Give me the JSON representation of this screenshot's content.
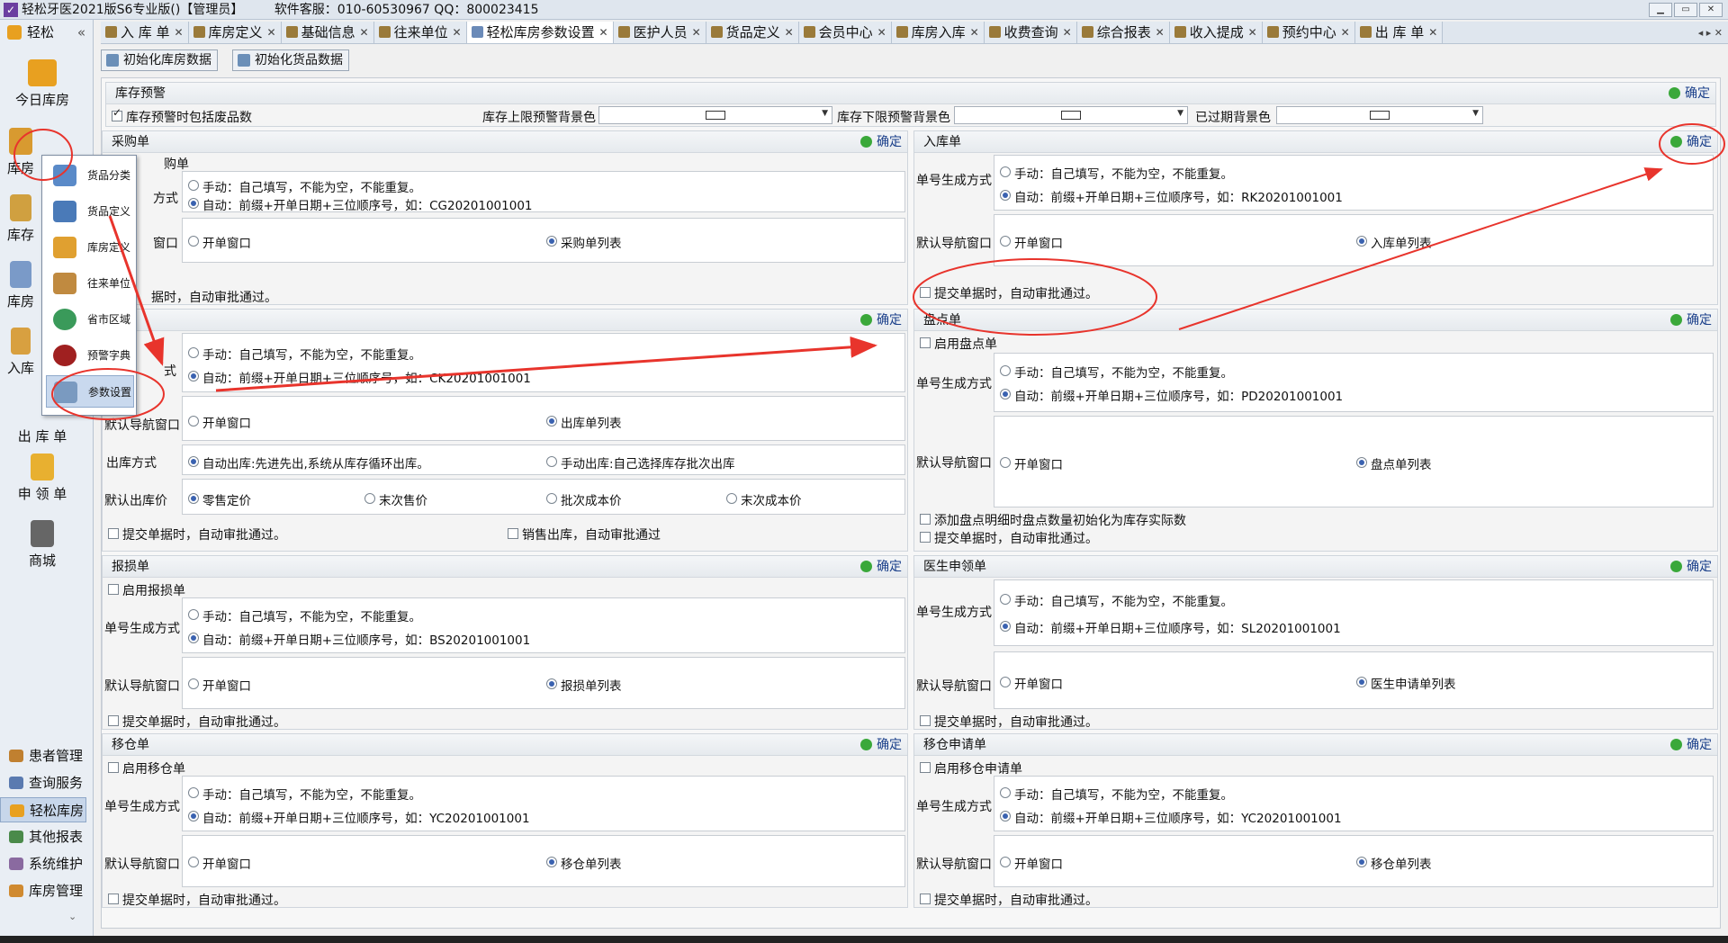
{
  "window": {
    "title": "轻松牙医2021版S6专业版()【管理员】",
    "service": "软件客服：010-60530967 QQ：800023415",
    "controls": [
      "▁",
      "▭",
      "✕"
    ]
  },
  "sidebar": {
    "header": "轻松",
    "collapse": "«",
    "big_items": [
      {
        "label": "今日库房"
      },
      {
        "label": "库房"
      },
      {
        "label": "库存"
      },
      {
        "label": "库房"
      },
      {
        "label": "入库"
      },
      {
        "label": "出 库 单"
      },
      {
        "label": "申 领 单"
      },
      {
        "label": "商城"
      }
    ],
    "bottom_items": [
      {
        "label": "患者管理"
      },
      {
        "label": "查询服务"
      },
      {
        "label": "轻松库房"
      },
      {
        "label": "其他报表"
      },
      {
        "label": "系统维护"
      },
      {
        "label": "库房管理"
      }
    ],
    "bottom_more": "⌄"
  },
  "popup_menu": {
    "items": [
      {
        "label": "货品分类"
      },
      {
        "label": "货品定义"
      },
      {
        "label": "库房定义"
      },
      {
        "label": "往来单位"
      },
      {
        "label": "省市区域"
      },
      {
        "label": "预警字典"
      },
      {
        "label": "参数设置"
      }
    ]
  },
  "tabs": [
    {
      "label": "入 库 单"
    },
    {
      "label": "库房定义"
    },
    {
      "label": "基础信息"
    },
    {
      "label": "往来单位"
    },
    {
      "label": "轻松库房参数设置"
    },
    {
      "label": "医护人员"
    },
    {
      "label": "货品定义"
    },
    {
      "label": "会员中心"
    },
    {
      "label": "库房入库"
    },
    {
      "label": "收费查询"
    },
    {
      "label": "综合报表"
    },
    {
      "label": "收入提成"
    },
    {
      "label": "预约中心"
    },
    {
      "label": "出 库 单"
    }
  ],
  "tab_close": "✕",
  "tab_nav": "◂ ▸ ✕",
  "toolbar": {
    "init_warehouse": "初始化库房数据",
    "init_goods": "初始化货品数据"
  },
  "common": {
    "confirm": "确定",
    "manual": "手动：自己填写，不能为空，不能重复。",
    "auto_prefix": "自动：前缀+开单日期+三位顺序号，如：",
    "number_label": "单号生成方式",
    "nav_label": "默认导航窗口",
    "open_window": "开单窗口",
    "submit_auto": "提交单据时，自动审批通过。"
  },
  "stock_warning": {
    "title": "库存预警",
    "include_waste": "库存预警时包括废品数",
    "upper_bg": "库存上限预警背景色",
    "lower_bg": "库存下限预警背景色",
    "expired_bg": "已过期背景色"
  },
  "purchase": {
    "title": "采购单",
    "sub": "购单",
    "example": "CG20201001001",
    "list": "采购单列表"
  },
  "inbound": {
    "title": "入库单",
    "example": "RK20201001001",
    "list": "入库单列表"
  },
  "outbound": {
    "example": "CK20201001001",
    "list": "出库单列表",
    "method_label": "出库方式",
    "auto_out": "自动出库:先进先出,系统从库存循环出库。",
    "manual_out": "手动出库:自己选择库存批次出库",
    "price_label": "默认出库价",
    "prices": [
      "零售定价",
      "末次售价",
      "批次成本价",
      "末次成本价"
    ],
    "sales_auto": "销售出库，自动审批通过"
  },
  "stocktake": {
    "title": "盘点单",
    "enable": "启用盘点单",
    "example": "PD20201001001",
    "list": "盘点单列表",
    "init_qty": "添加盘点明细时盘点数量初始化为库存实际数"
  },
  "damage": {
    "title": "报损单",
    "enable": "启用报损单",
    "example": "BS20201001001",
    "list": "报损单列表"
  },
  "requisition": {
    "title": "医生申领单",
    "example": "SL20201001001",
    "list": "医生申请单列表"
  },
  "transfer": {
    "title": "移仓单",
    "enable": "启用移仓单",
    "example": "YC20201001001",
    "list": "移仓单列表"
  },
  "transfer_req": {
    "title": "移仓申请单",
    "enable": "启用移仓申请单",
    "example": "YC20201001001",
    "list": "移仓单列表"
  },
  "clip": {
    "fangshi": "方式",
    "chuangkou": "窗口",
    "shi": "式",
    "ju": "据时，自动审批通过。"
  },
  "colors": {
    "accent": "#1a3f8a",
    "annotation": "#e8342c",
    "check": "#3aa83a"
  }
}
